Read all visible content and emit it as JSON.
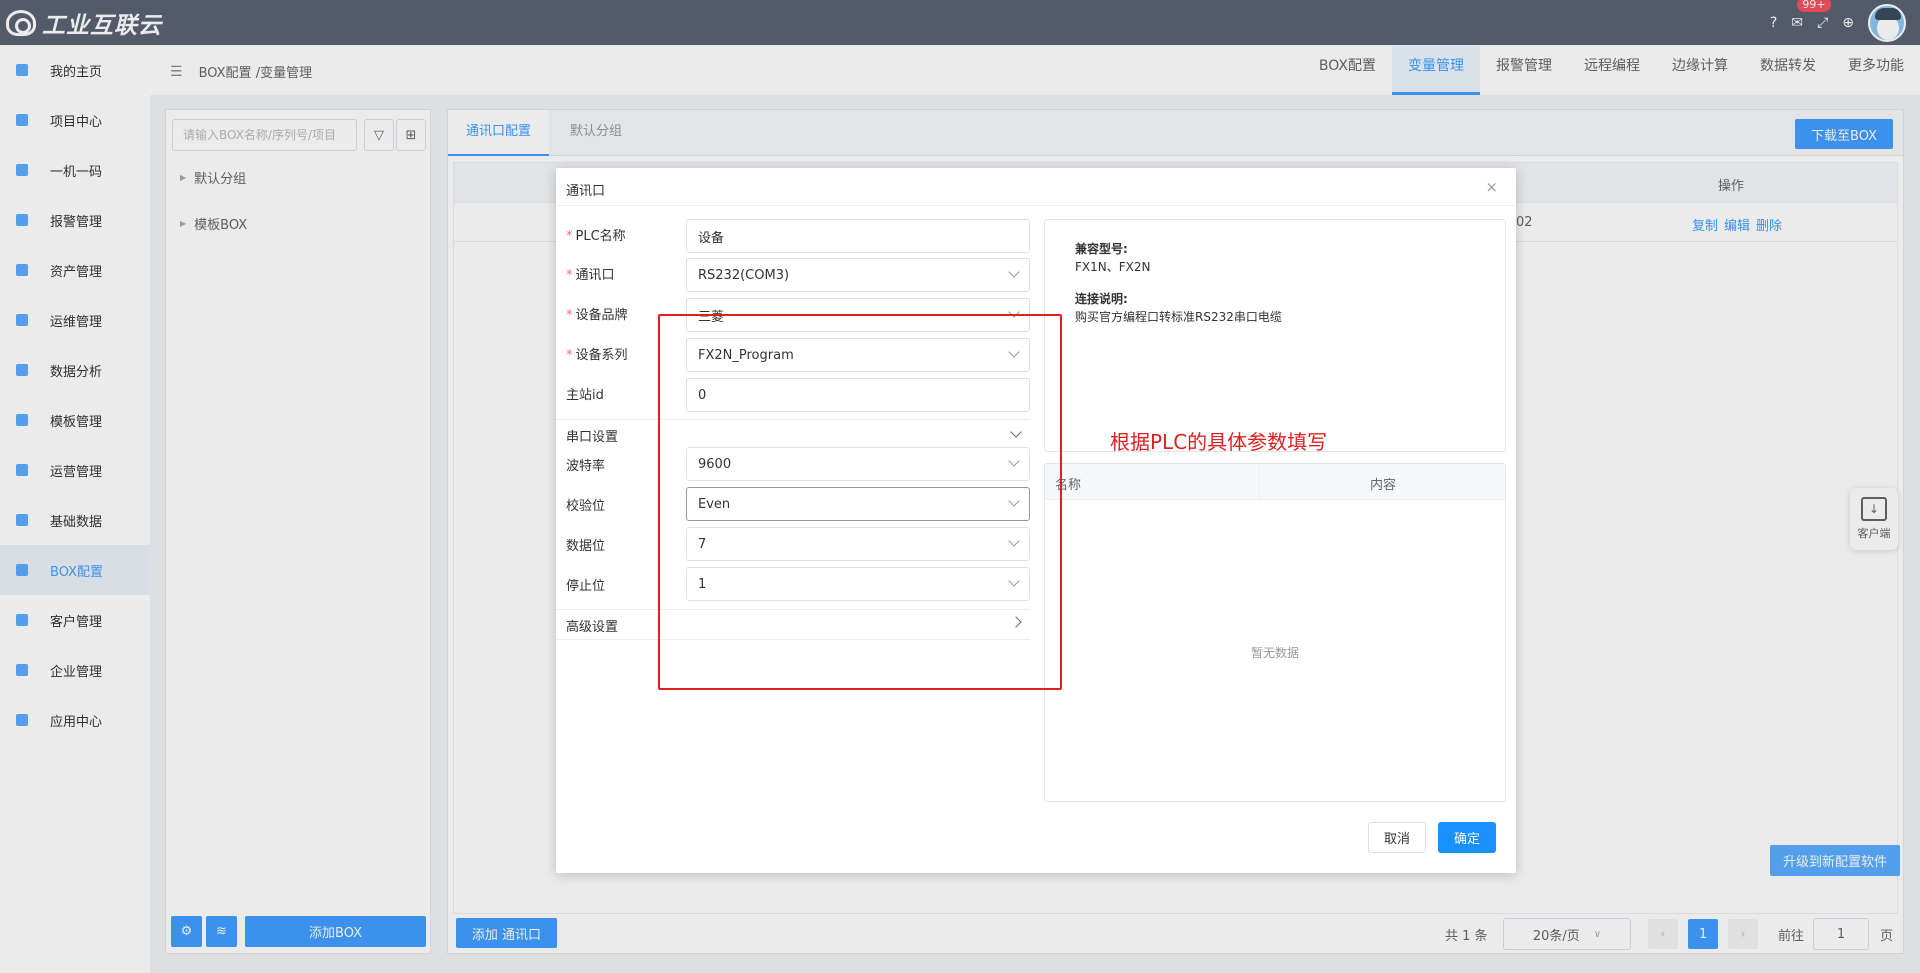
{
  "app": {
    "title": "工业互联云",
    "badge": "99+"
  },
  "sidebar": {
    "items": [
      {
        "label": "我的主页"
      },
      {
        "label": "项目中心"
      },
      {
        "label": "一机一码"
      },
      {
        "label": "报警管理"
      },
      {
        "label": "资产管理"
      },
      {
        "label": "运维管理"
      },
      {
        "label": "数据分析"
      },
      {
        "label": "模板管理"
      },
      {
        "label": "运营管理"
      },
      {
        "label": "基础数据"
      },
      {
        "label": "BOX配置"
      },
      {
        "label": "客户管理"
      },
      {
        "label": "企业管理"
      },
      {
        "label": "应用中心"
      }
    ],
    "active": "BOX配置"
  },
  "breadcrumb": "BOX配置 /变量管理",
  "navtabs": [
    "BOX配置",
    "变量管理",
    "报警管理",
    "远程编程",
    "边缘计算",
    "数据转发",
    "更多功能"
  ],
  "leftpanel": {
    "search_placeholder": "请输入BOX名称/序列号/项目",
    "tree": [
      "默认分组",
      "模板BOX"
    ],
    "add_box": "添加BOX"
  },
  "main": {
    "tabs": [
      "通讯口配置",
      "默认分组"
    ],
    "download": "下载至BOX",
    "table": {
      "op_header": "操作",
      "row": {
        "partial": "02",
        "copy": "复制",
        "edit": "编辑",
        "delete": "删除"
      }
    },
    "add_port": "添加 通讯口",
    "pager": {
      "total": "共 1 条",
      "size": "20条/页",
      "page": "1",
      "goto": "前往",
      "goto_value": "1",
      "unit": "页"
    },
    "upgrade": "升级到新配置软件",
    "client": "客户端"
  },
  "modal": {
    "title": "通讯口",
    "fields": {
      "plc_name": {
        "label": "PLC名称",
        "value": "设备"
      },
      "port": {
        "label": "通讯口",
        "value": "RS232(COM3)"
      },
      "brand": {
        "label": "设备品牌",
        "value": "三菱"
      },
      "series": {
        "label": "设备系列",
        "value": "FX2N_Program"
      },
      "station": {
        "label": "主站id",
        "value": "0"
      }
    },
    "serial_section": "串口设置",
    "serial": {
      "baud": {
        "label": "波特率",
        "value": "9600"
      },
      "parity": {
        "label": "校验位",
        "value": "Even"
      },
      "databits": {
        "label": "数据位",
        "value": "7"
      },
      "stopbits": {
        "label": "停止位",
        "value": "1"
      }
    },
    "advanced": "高级设置",
    "info": {
      "compat_label": "兼容型号:",
      "compat_value": "FX1N、FX2N",
      "conn_label": "连接说明:",
      "conn_value": "购买官方编程口转标准RS232串口电缆"
    },
    "param_table": {
      "col1": "名称",
      "col2": "内容",
      "empty": "暂无数据"
    },
    "cancel": "取消",
    "ok": "确定"
  },
  "annotation": "根据PLC的具体参数填写",
  "colors": {
    "accent": "#409eff",
    "annotation": "#e02020",
    "topbar": "#5b6373"
  }
}
